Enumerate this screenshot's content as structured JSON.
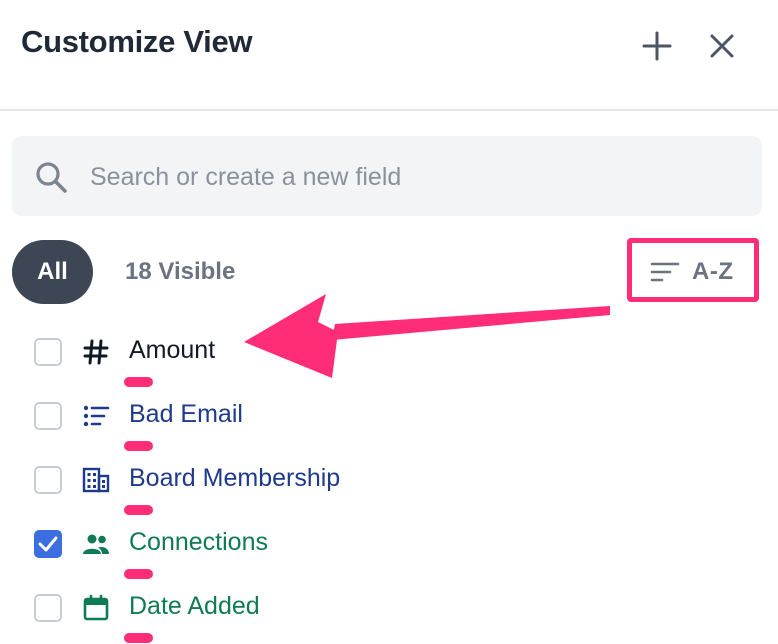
{
  "header": {
    "title": "Customize View",
    "add_icon": "plus-icon",
    "close_icon": "close-icon"
  },
  "search": {
    "placeholder": "Search or create a new field",
    "value": "",
    "icon": "search-icon"
  },
  "filter": {
    "all_label": "All",
    "visible_count": "18 Visible",
    "sort_label": "A-Z",
    "sort_icon": "sort-lines-icon"
  },
  "fields": [
    {
      "label": "Amount",
      "icon": "hash-icon",
      "checked": false,
      "color": "#111827"
    },
    {
      "label": "Bad Email",
      "icon": "list-icon",
      "checked": false,
      "color": "#1e3a8a"
    },
    {
      "label": "Board Membership",
      "icon": "building-icon",
      "checked": false,
      "color": "#1e3a8a"
    },
    {
      "label": "Connections",
      "icon": "people-icon",
      "checked": true,
      "color": "#0f7a55"
    },
    {
      "label": "Date Added",
      "icon": "calendar-icon",
      "checked": false,
      "color": "#0f7a55"
    }
  ],
  "colors": {
    "annotation": "#ff2d78",
    "checkbox_checked": "#3b6fe0",
    "pill_bg": "#3d4654"
  }
}
